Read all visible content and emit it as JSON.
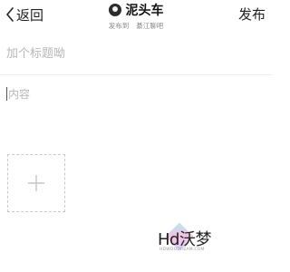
{
  "header": {
    "back_label": "返回",
    "title": "泥头车",
    "subtitle_prefix": "发布到",
    "subtitle_target": "綦江聊吧",
    "publish_label": "发布"
  },
  "editor": {
    "title_placeholder": "加个标题呦",
    "content_placeholder": "内容"
  },
  "icons": {
    "back": "chevron-left-icon",
    "avatar": "avatar",
    "add_image": "plus-icon"
  },
  "watermark": {
    "logo_text": "Hd沃梦",
    "sub_text": "HDWOODREAM.COM"
  },
  "colors": {
    "text": "#222222",
    "placeholder": "#b7b7b7",
    "divider": "#ededed",
    "dashed_border": "#c9c9c9"
  }
}
